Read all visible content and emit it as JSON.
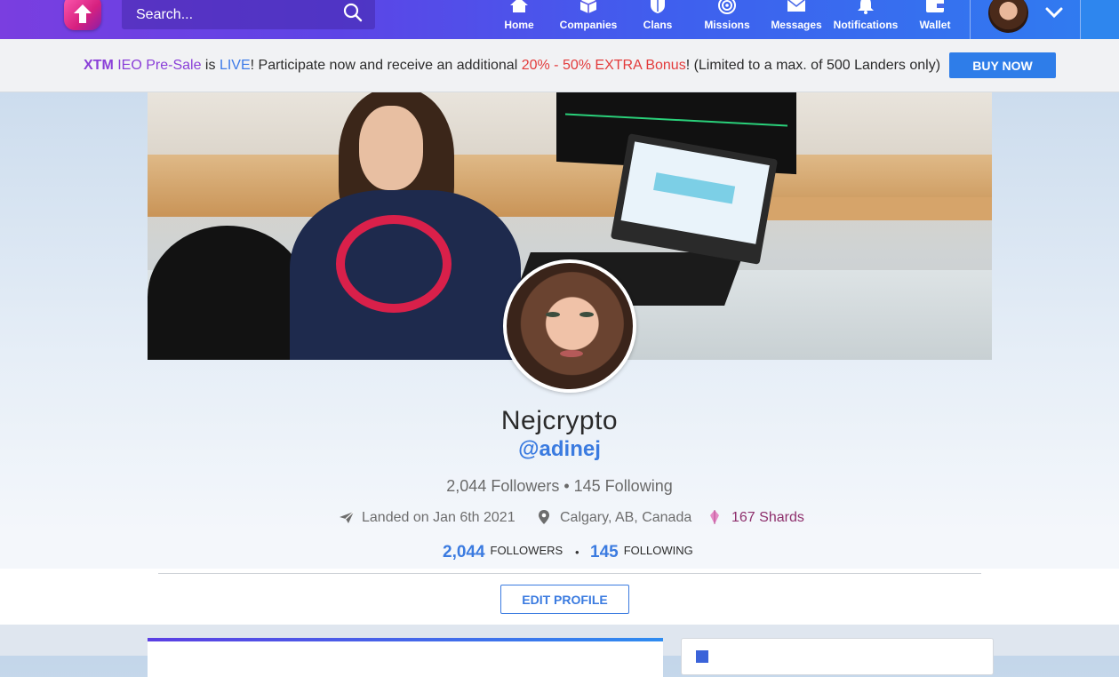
{
  "nav": {
    "search_placeholder": "Search...",
    "items": [
      {
        "label": "Home",
        "icon": "home-icon"
      },
      {
        "label": "Companies",
        "icon": "cube-icon"
      },
      {
        "label": "Clans",
        "icon": "shield-icon"
      },
      {
        "label": "Missions",
        "icon": "target-icon"
      },
      {
        "label": "Messages",
        "icon": "envelope-icon"
      },
      {
        "label": "Notifications",
        "icon": "bell-icon"
      },
      {
        "label": "Wallet",
        "icon": "wallet-icon"
      }
    ]
  },
  "banner": {
    "part1": "XTM",
    "part2": " IEO Pre-Sale",
    "part3": " is ",
    "part4": "LIVE",
    "part5": "! Participate now and receive an additional ",
    "part6": "20% - 50% EXTRA Bonus",
    "part7": "! (Limited to a max. of 500 Landers only)",
    "button": "BUY NOW"
  },
  "profile": {
    "name": "Nejcrypto",
    "handle": "@adinej",
    "counts_line": "2,044 Followers • 145 Following",
    "landed": "Landed on Jan 6th 2021",
    "location": "Calgary, AB, Canada",
    "shards": "167 Shards",
    "followers_num": "2,044",
    "followers_label": "FOLLOWERS",
    "separator": "•",
    "following_num": "145",
    "following_label": "FOLLOWING",
    "edit_button": "EDIT PROFILE"
  },
  "colors": {
    "nav_start": "#7a3ee0",
    "nav_end": "#2f7df0",
    "accent_blue": "#3b7be0",
    "bonus_red": "#e33b3b",
    "xtm_purple": "#8a3fd8",
    "shards_color": "#8e2f6c"
  }
}
